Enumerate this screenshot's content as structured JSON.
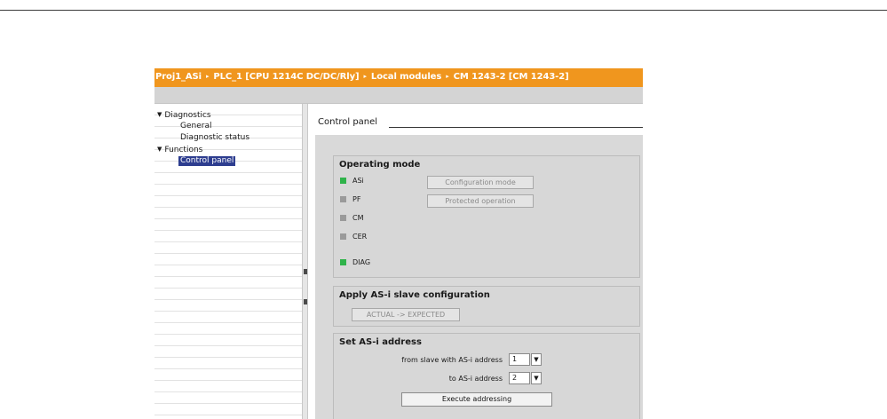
{
  "breadcrumb": {
    "items": [
      "Proj1_ASi",
      "PLC_1 [CPU 1214C DC/DC/Rly]",
      "Local modules",
      "CM 1243-2 [CM 1243-2]"
    ],
    "separator": "▸"
  },
  "tree": {
    "diagnostics": "Diagnostics",
    "general": "General",
    "diagnostic_status": "Diagnostic status",
    "functions": "Functions",
    "control_panel": "Control panel",
    "caret": "▼"
  },
  "control_panel": {
    "title": "Control panel",
    "operating_mode": {
      "title": "Operating mode",
      "leds": [
        {
          "label": "ASi",
          "on": true
        },
        {
          "label": "PF",
          "on": false
        },
        {
          "label": "CM",
          "on": false
        },
        {
          "label": "CER",
          "on": false
        },
        {
          "label": "DIAG",
          "on": true
        }
      ],
      "configuration_mode_button": "Configuration mode",
      "protected_operation_button": "Protected operation"
    },
    "apply_config": {
      "title": "Apply AS-i slave configuration",
      "button": "ACTUAL -> EXPECTED"
    },
    "set_address": {
      "title": "Set AS-i address",
      "from_label": "from slave with AS-i address",
      "from_value": "1",
      "to_label": "to AS-i address",
      "to_value": "2",
      "execute_button": "Execute addressing",
      "dropdown_arrow": "▼"
    }
  },
  "colors": {
    "titlebar": "#f0961e",
    "led_on": "#2fb34a",
    "led_off": "#9a9a9a",
    "selection": "#2d3d8f"
  }
}
